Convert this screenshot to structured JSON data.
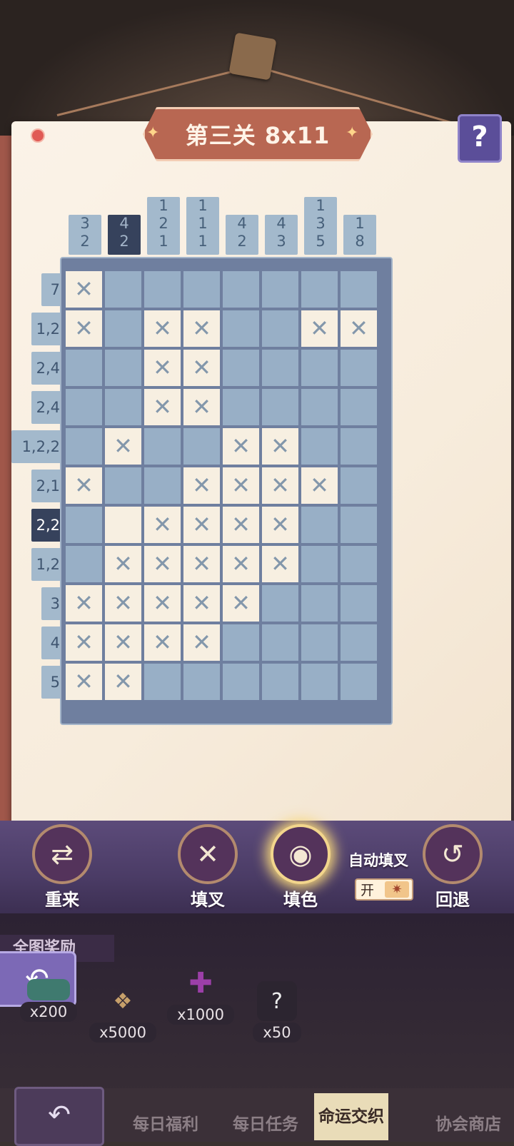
{
  "level_title": "第三关 8x11",
  "help_label": "?",
  "columns": [
    {
      "clue": [
        "3",
        "2"
      ],
      "active": false
    },
    {
      "clue": [
        "4",
        "2"
      ],
      "active": true
    },
    {
      "clue": [
        "1",
        "2",
        "1"
      ],
      "active": false
    },
    {
      "clue": [
        "1",
        "1",
        "1"
      ],
      "active": false
    },
    {
      "clue": [
        "4",
        "2"
      ],
      "active": false
    },
    {
      "clue": [
        "4",
        "3"
      ],
      "active": false
    },
    {
      "clue": [
        "1",
        "3",
        "5"
      ],
      "active": false
    },
    {
      "clue": [
        "1",
        "8"
      ],
      "active": false
    }
  ],
  "rows": [
    {
      "clue": "7",
      "active": false,
      "cells": "xfffffff"
    },
    {
      "clue": "1,2",
      "active": false,
      "cells": "xfxxffxx"
    },
    {
      "clue": "2,4",
      "active": false,
      "cells": "ffxxffff"
    },
    {
      "clue": "2,4",
      "active": false,
      "cells": "ffxxffff"
    },
    {
      "clue": "1,2,2",
      "active": false,
      "cells": "fxffxxff"
    },
    {
      "clue": "2,1",
      "active": false,
      "cells": "xffxxxxf"
    },
    {
      "clue": "2,2",
      "active": true,
      "cells": "fbxxxxff"
    },
    {
      "clue": "1,2",
      "active": false,
      "cells": "fxxxxxff"
    },
    {
      "clue": "3",
      "active": false,
      "cells": "xxxxxfff"
    },
    {
      "clue": "4",
      "active": false,
      "cells": "xxxxffff"
    },
    {
      "clue": "5",
      "active": false,
      "cells": "xxffffffx"
    }
  ],
  "toolbar": {
    "restart_label": "重来",
    "mark_x_label": "填叉",
    "fill_label": "填色",
    "undo_label": "回退",
    "auto_fill_label": "自动填叉",
    "auto_fill_state": "开"
  },
  "rewards": {
    "title": "全图奖励",
    "items": [
      {
        "amount": "x200"
      },
      {
        "amount": "x5000"
      },
      {
        "amount": "x1000"
      },
      {
        "amount": "x50"
      }
    ]
  },
  "nav": {
    "tabs": [
      {
        "label": "每日福利",
        "active": false
      },
      {
        "label": "每日任务",
        "active": false
      },
      {
        "label": "命运交织",
        "active": true
      },
      {
        "label": "协会商店",
        "active": false
      }
    ]
  }
}
